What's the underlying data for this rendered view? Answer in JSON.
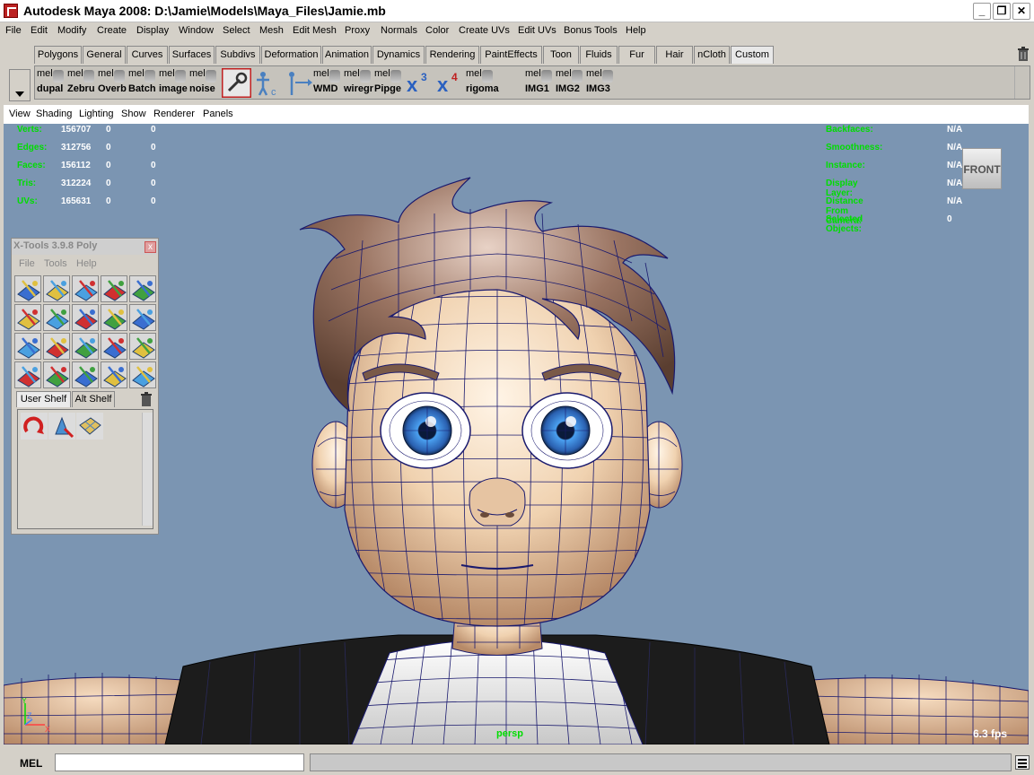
{
  "window": {
    "title": "Autodesk Maya 2008: D:\\Jamie\\Models\\Maya_Files\\Jamie.mb"
  },
  "menus": [
    "File",
    "Edit",
    "Modify",
    "Create",
    "Display",
    "Window",
    "Select",
    "Mesh",
    "Edit Mesh",
    "Proxy",
    "Normals",
    "Color",
    "Create UVs",
    "Edit UVs",
    "Bonus Tools",
    "Help"
  ],
  "shelf_tabs": [
    "Polygons",
    "General",
    "Curves",
    "Surfaces",
    "Subdivs",
    "Deformation",
    "Animation",
    "Dynamics",
    "Rendering",
    "PaintEffects",
    "Toon",
    "Fluids",
    "Fur",
    "Hair",
    "nCloth",
    "Custom"
  ],
  "active_shelf_tab": "Custom",
  "shelf_buttons": [
    {
      "top": "mel",
      "label": "dupal"
    },
    {
      "top": "mel",
      "label": "Zebru"
    },
    {
      "top": "mel",
      "label": "Overb"
    },
    {
      "top": "mel",
      "label": "Batch"
    },
    {
      "top": "mel",
      "label": "image"
    },
    {
      "top": "mel",
      "label": "noise"
    },
    {
      "top": "",
      "label": "",
      "icon": "wrench-icon"
    },
    {
      "top": "",
      "label": "",
      "icon": "figure-c-icon"
    },
    {
      "top": "",
      "label": "",
      "icon": "figure-arrow-icon"
    },
    {
      "top": "mel",
      "label": "WMD"
    },
    {
      "top": "mel",
      "label": "wiregr"
    },
    {
      "top": "mel",
      "label": "Pipge"
    },
    {
      "top": "",
      "label": "",
      "icon": "xtools-3-icon"
    },
    {
      "top": "",
      "label": "",
      "icon": "xtools-4-icon"
    },
    {
      "top": "mel",
      "label": "rigoma"
    },
    {
      "top": "mel",
      "label": "IMG1"
    },
    {
      "top": "mel",
      "label": "IMG2"
    },
    {
      "top": "mel",
      "label": "IMG3"
    }
  ],
  "panel_menus": [
    "View",
    "Shading",
    "Lighting",
    "Show",
    "Renderer",
    "Panels"
  ],
  "hud_left": [
    {
      "label": "Verts:",
      "a": "156707",
      "b": "0",
      "c": "0"
    },
    {
      "label": "Edges:",
      "a": "312756",
      "b": "0",
      "c": "0"
    },
    {
      "label": "Faces:",
      "a": "156112",
      "b": "0",
      "c": "0"
    },
    {
      "label": "Tris:",
      "a": "312224",
      "b": "0",
      "c": "0"
    },
    {
      "label": "UVs:",
      "a": "165631",
      "b": "0",
      "c": "0"
    }
  ],
  "hud_right": [
    {
      "label": "Backfaces:",
      "value": "N/A"
    },
    {
      "label": "Smoothness:",
      "value": "N/A"
    },
    {
      "label": "Instance:",
      "value": "N/A"
    },
    {
      "label": "Display Layer:",
      "value": "N/A"
    },
    {
      "label": "Distance From Camera:",
      "value": "N/A"
    },
    {
      "label": "Selected Objects:",
      "value": "0"
    }
  ],
  "viewcube": "FRONT",
  "camera": "persp",
  "fps": "6.3 fps",
  "axis": {
    "y": "Y",
    "x": "X",
    "z": "Z"
  },
  "xtools": {
    "title": "X-Tools 3.9.8 Poly",
    "close": "x",
    "menus": [
      "File",
      "Tools",
      "Help"
    ],
    "tabs": [
      "User Shelf",
      "Alt Shelf"
    ],
    "active_tab": "User Shelf"
  },
  "cmdline": {
    "label": "MEL",
    "value": ""
  },
  "colors": {
    "viewport_bg": "#7b95b2",
    "hud_label": "#00dd00",
    "hud_value": "#ffffff",
    "wireframe": "#1a1a6e",
    "skin": "#f0d2b0",
    "hair": "#7a5a48",
    "iris": "#2a74c8"
  }
}
